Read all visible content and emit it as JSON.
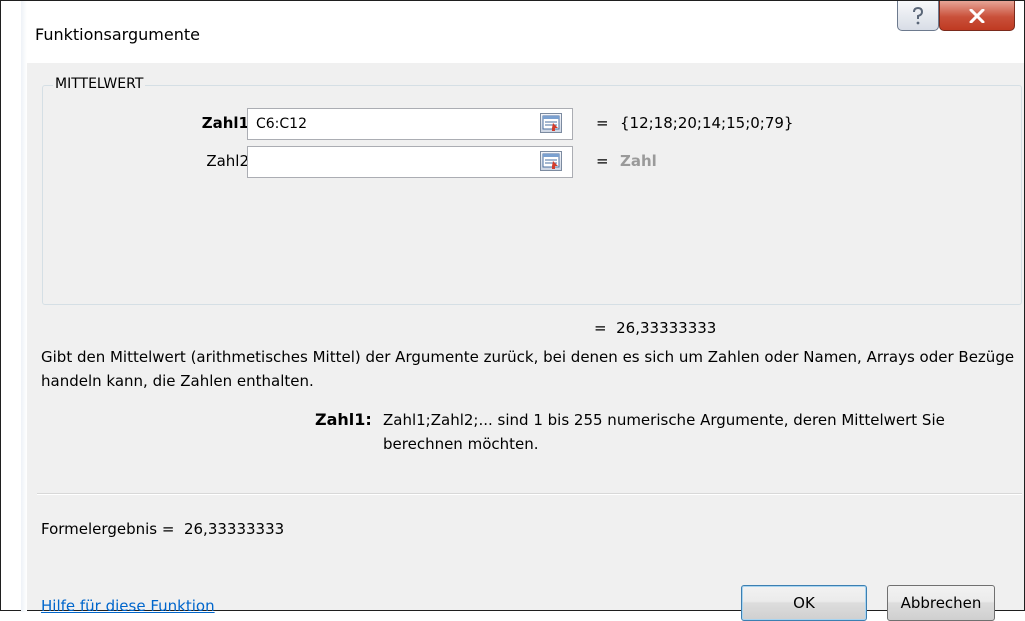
{
  "window": {
    "title": "Funktionsargumente",
    "help_symbol": "?",
    "close_symbol": "X"
  },
  "group": {
    "label": "MITTELWERT"
  },
  "arguments": [
    {
      "label": "Zahl1",
      "value": "C6:C12",
      "placeholder": "",
      "result": "{12;18;20;14;15;0;79}",
      "bold": true
    },
    {
      "label": "Zahl2",
      "value": "",
      "placeholder": "",
      "result": "Zahl",
      "bold": false
    }
  ],
  "equals": "=",
  "function_result": "26,33333333",
  "description": "Gibt den Mittelwert (arithmetisches Mittel) der Argumente zurück, bei denen es sich um Zahlen oder Namen, Arrays oder Bezüge handeln kann, die Zahlen enthalten.",
  "argument_help": {
    "name": "Zahl1:",
    "text": "Zahl1;Zahl2;... sind 1 bis 255 numerische Argumente, deren Mittelwert Sie berechnen möchten."
  },
  "formula_result": {
    "label": "Formelergebnis =",
    "value": "26,33333333"
  },
  "help_link": "Hilfe für diese Funktion",
  "buttons": {
    "ok": "OK",
    "cancel": "Abbrechen"
  },
  "icons": {
    "collapse": "collapse-dialog-icon",
    "help": "help-icon",
    "close": "close-icon"
  },
  "colors": {
    "link": "#0066cc",
    "close_button": "#c9503a",
    "hint_text": "#9a9a9a"
  }
}
